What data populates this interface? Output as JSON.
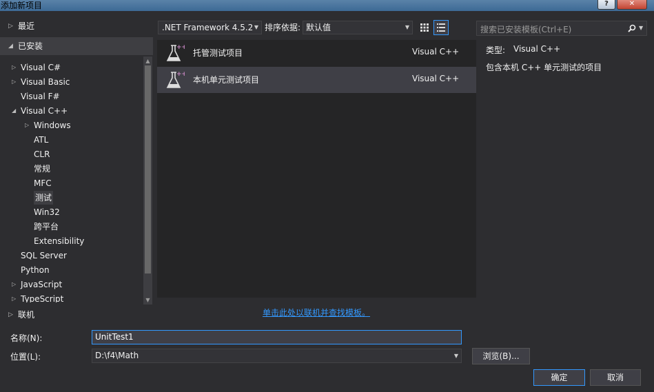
{
  "window": {
    "title": "添加新项目",
    "help_label": "?",
    "close_label": "✕"
  },
  "tree": {
    "recent": "最近",
    "installed": "已安装",
    "online": "联机",
    "items": [
      {
        "label": "Visual C#",
        "arrow": "▷"
      },
      {
        "label": "Visual Basic",
        "arrow": "▷"
      },
      {
        "label": "Visual F#",
        "arrow": ""
      },
      {
        "label": "Visual C++",
        "arrow": "◢"
      },
      {
        "label": "Windows",
        "arrow": "▷"
      },
      {
        "label": "ATL",
        "arrow": ""
      },
      {
        "label": "CLR",
        "arrow": ""
      },
      {
        "label": "常规",
        "arrow": ""
      },
      {
        "label": "MFC",
        "arrow": ""
      },
      {
        "label": "测试",
        "arrow": ""
      },
      {
        "label": "Win32",
        "arrow": ""
      },
      {
        "label": "跨平台",
        "arrow": ""
      },
      {
        "label": "Extensibility",
        "arrow": ""
      },
      {
        "label": "SQL Server",
        "arrow": ""
      },
      {
        "label": "Python",
        "arrow": ""
      },
      {
        "label": "JavaScript",
        "arrow": "▷"
      },
      {
        "label": "TypeScript",
        "arrow": "▷"
      }
    ]
  },
  "toolbar": {
    "framework": ".NET Framework 4.5.2",
    "sort_label": "排序依据:",
    "sort_value": "默认值"
  },
  "templates": [
    {
      "name": "托管测试项目",
      "lang": "Visual C++",
      "selected": false
    },
    {
      "name": "本机单元测试项目",
      "lang": "Visual C++",
      "selected": true
    }
  ],
  "online_link": "单击此处以联机并查找模板。",
  "search": {
    "placeholder": "搜索已安装模板(Ctrl+E)"
  },
  "info": {
    "type_label": "类型:",
    "type_value": "Visual C++",
    "description": "包含本机 C++ 单元测试的项目"
  },
  "form": {
    "name_label": "名称(N):",
    "name_value": "UnitTest1",
    "location_label": "位置(L):",
    "location_value": "D:\\f4\\Math",
    "browse_label": "浏览(B)...",
    "ok_label": "确定",
    "cancel_label": "取消"
  },
  "colors": {
    "background": "#2d2d30",
    "accent": "#3399ff",
    "selection": "#3f3f46"
  }
}
